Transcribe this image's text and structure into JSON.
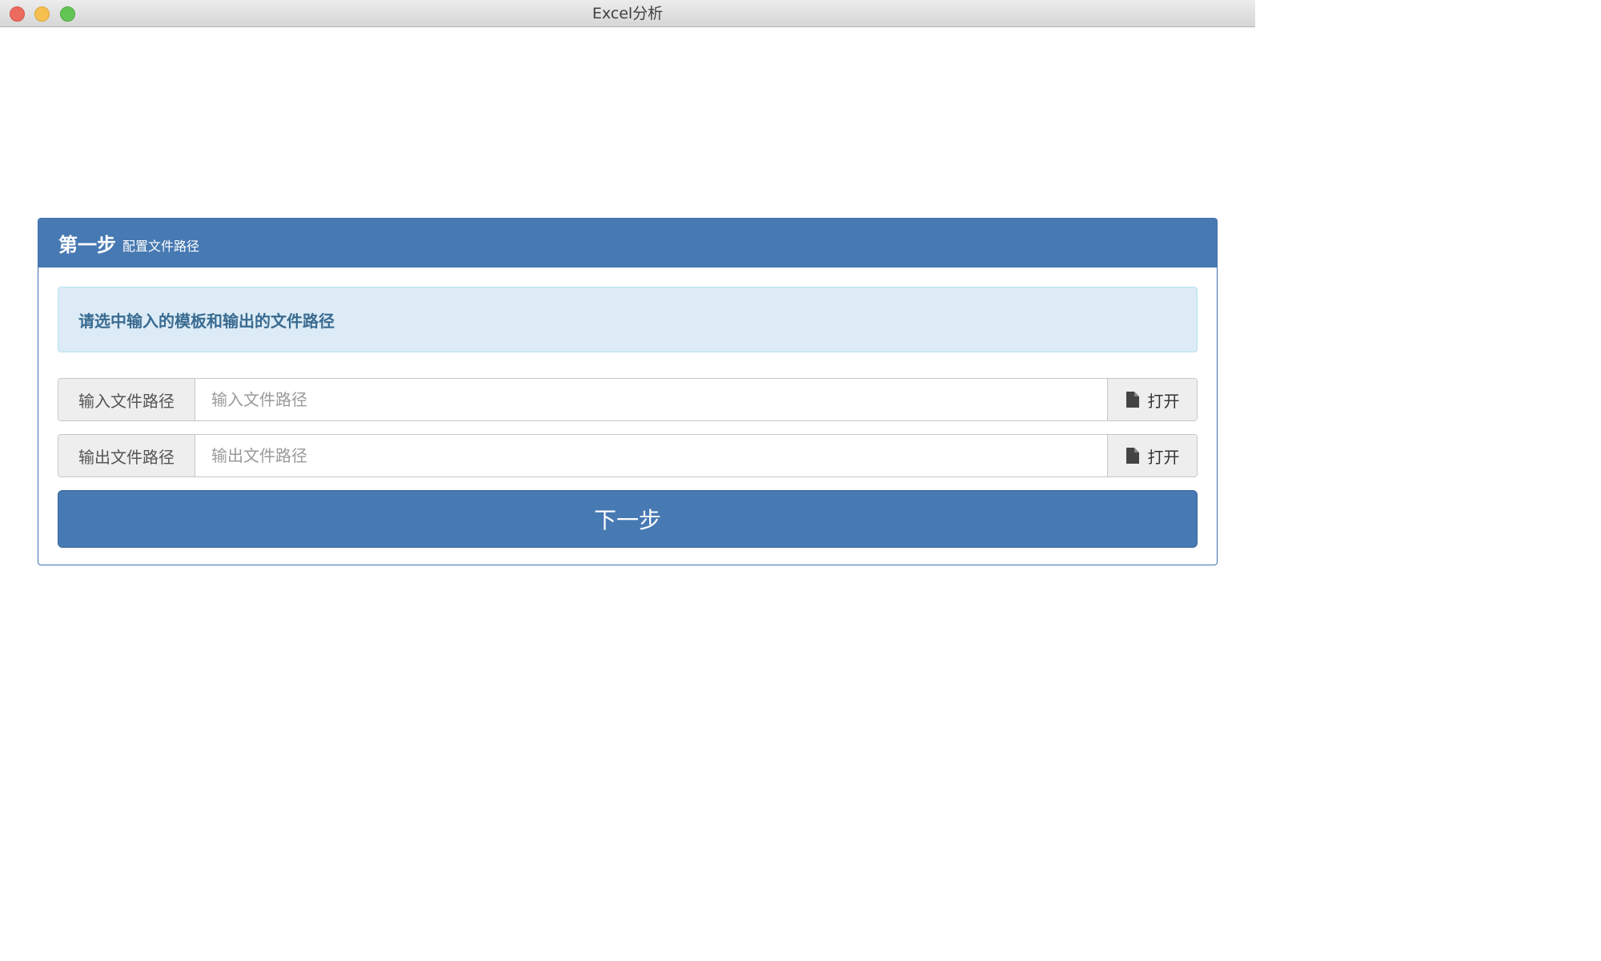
{
  "window": {
    "title": "Excel分析"
  },
  "panel": {
    "title": "第一步",
    "subtitle": "配置文件路径"
  },
  "alert": {
    "text": "请选中输入的模板和输出的文件路径"
  },
  "input_path": {
    "label": "输入文件路径",
    "value": "",
    "placeholder": "输入文件路径",
    "button_label": "打开",
    "button_icon": "file-icon"
  },
  "output_path": {
    "label": "输出文件路径",
    "value": "",
    "placeholder": "输出文件路径",
    "button_label": "打开",
    "button_icon": "file-icon"
  },
  "next_button": {
    "label": "下一步"
  },
  "colors": {
    "primary": "#4779b3",
    "alert_bg": "#dcebf6",
    "alert_text": "#3a6b91"
  }
}
